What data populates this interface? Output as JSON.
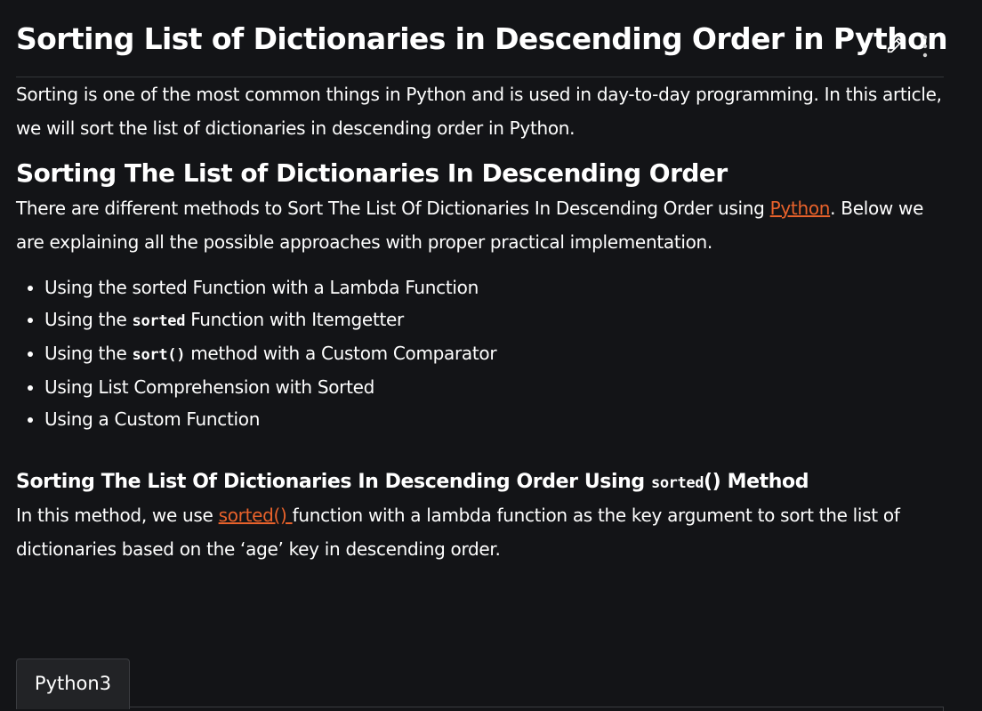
{
  "article": {
    "title": "Sorting List of Dictionaries in Descending Order in Python",
    "intro": "Sorting is one of the most common things in Python and is used in day-to-day programming. In this article, we will sort the list of dictionaries in descending order in Python.",
    "section_heading": "Sorting The List of Dictionaries In Descending Order",
    "methods_intro_before": "There are different methods to Sort The List Of Dictionaries In Descending Order using ",
    "methods_intro_link": "Python",
    "methods_intro_after": ". Below we are explaining all the possible approaches with proper practical implementation.",
    "approaches": [
      {
        "text": "Using the sorted Function with a Lambda Function"
      },
      {
        "before": "Using the ",
        "code": "sorted",
        "after": " Function with Itemgetter"
      },
      {
        "before": "Using the ",
        "code": "sort()",
        "after": " method with a Custom Comparator"
      },
      {
        "text": "Using List Comprehension with Sorted"
      },
      {
        "text": "Using a Custom Function"
      }
    ],
    "subheading_before": "Sorting The List Of Dictionaries In Descending Order Using ",
    "subheading_code": "sorted",
    "subheading_after": "() Method",
    "method_desc_before": "In this method, we use ",
    "method_desc_link": "sorted() ",
    "method_desc_after": "function with a lambda function as the key argument to sort the list of dictionaries based on the ‘age’ key in descending order.",
    "code_tab_label": "Python3"
  },
  "icons": {
    "edit": "pencil-icon",
    "more": "more-vertical-icon"
  },
  "colors": {
    "background": "#131417",
    "text": "#ffffff",
    "link": "#e8622b"
  }
}
